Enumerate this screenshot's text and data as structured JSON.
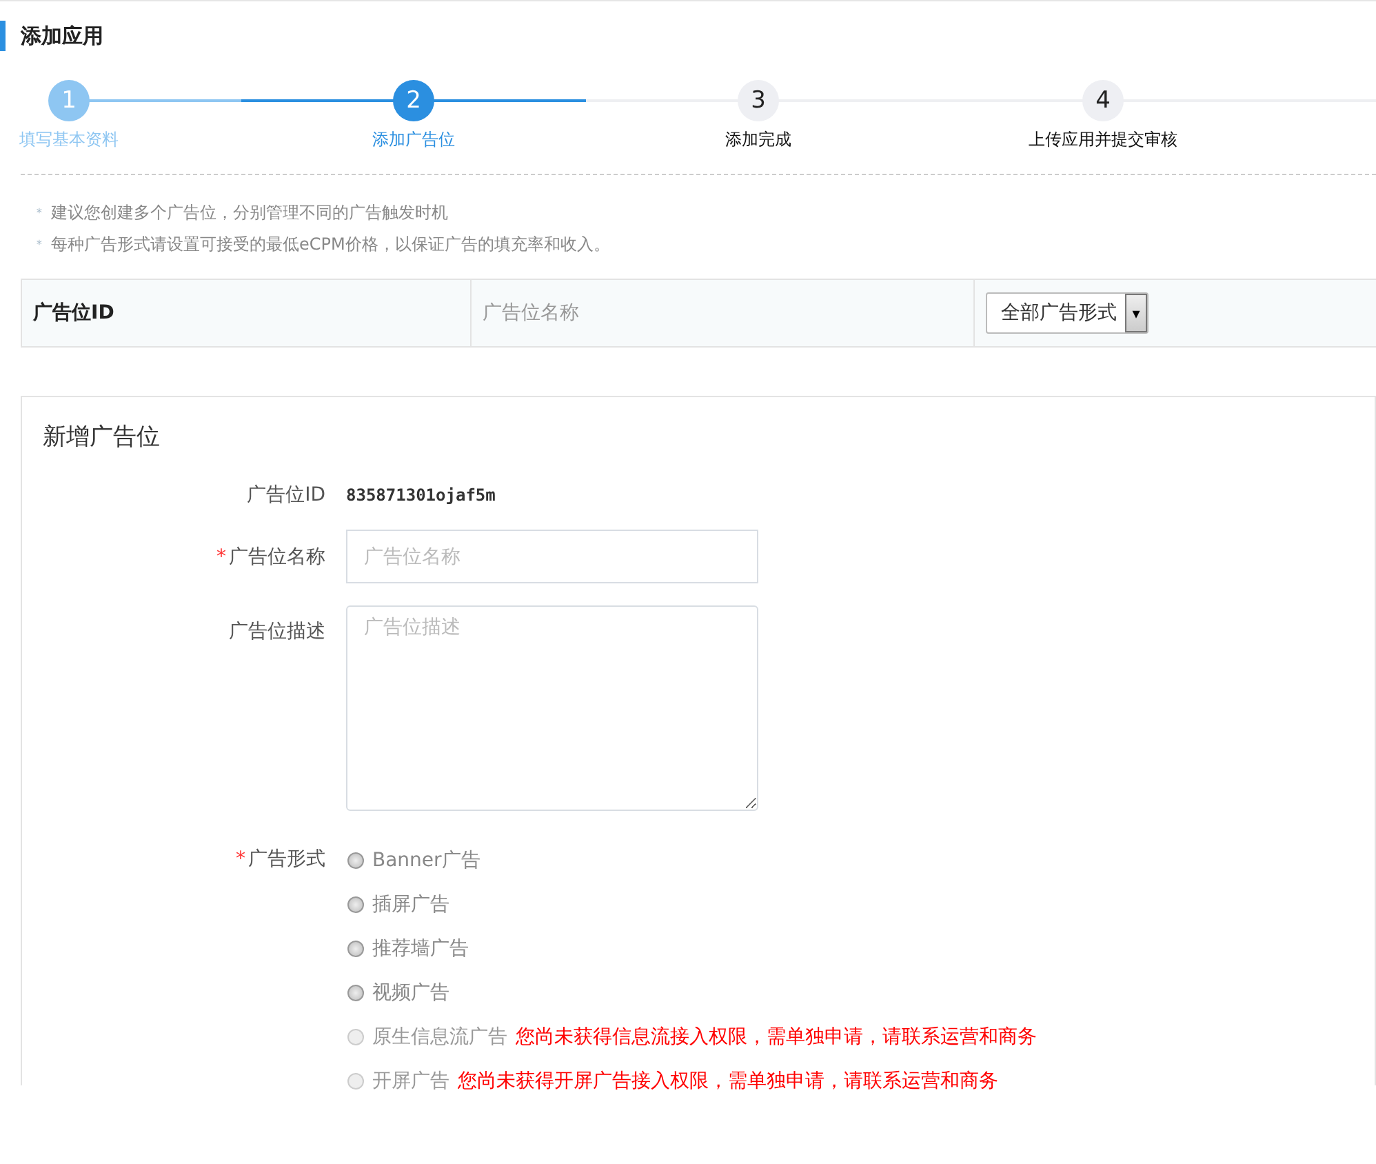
{
  "page": {
    "title": "添加应用"
  },
  "steps": [
    {
      "number": "1",
      "label": "填写基本资料",
      "completed": true,
      "selected": false
    },
    {
      "number": "2",
      "label": "添加广告位",
      "completed": false,
      "selected": true
    },
    {
      "number": "3",
      "label": "添加完成",
      "completed": false,
      "selected": false
    },
    {
      "number": "4",
      "label": "上传应用并提交审核",
      "completed": false,
      "selected": false
    }
  ],
  "notes": [
    {
      "bullet": "＊",
      "text": "建议您创建多个广告位，分别管理不同的广告触发时机"
    },
    {
      "bullet": "＊",
      "text": "每种广告形式请设置可接受的最低eCPM价格，以保证广告的填充率和收入。"
    }
  ],
  "filter_bar": {
    "column_1": "广告位ID",
    "name_field": {
      "placeholder": "广告位名称"
    },
    "type_select": {
      "value": "全部广告形式",
      "arrow": "▾"
    }
  },
  "form": {
    "title": "新增广告位",
    "id_row": {
      "label": "广告位ID",
      "value": "835871301ojaf5m"
    },
    "name_row": {
      "required_mark": "*",
      "label": "广告位名称",
      "placeholder": "广告位名称"
    },
    "description_row": {
      "label": "广告位描述",
      "placeholder": "广告位描述"
    },
    "type_row": {
      "required_mark": "*",
      "label": "广告形式",
      "options": [
        {
          "label": "Banner广告",
          "selected": false,
          "disabled": false
        },
        {
          "label": "插屏广告",
          "selected": false,
          "disabled": false
        },
        {
          "label": "推荐墙广告",
          "selected": false,
          "disabled": false
        },
        {
          "label": "视频广告",
          "selected": false,
          "disabled": false
        },
        {
          "label": "原生信息流广告",
          "selected": false,
          "disabled": true,
          "notice": "您尚未获得信息流接入权限，需单独申请，请联系运营和商务"
        },
        {
          "label": "开屏广告",
          "selected": false,
          "disabled": true,
          "notice": "您尚未获得开屏广告接入权限，需单独申请，请联系运营和商务"
        }
      ]
    }
  }
}
